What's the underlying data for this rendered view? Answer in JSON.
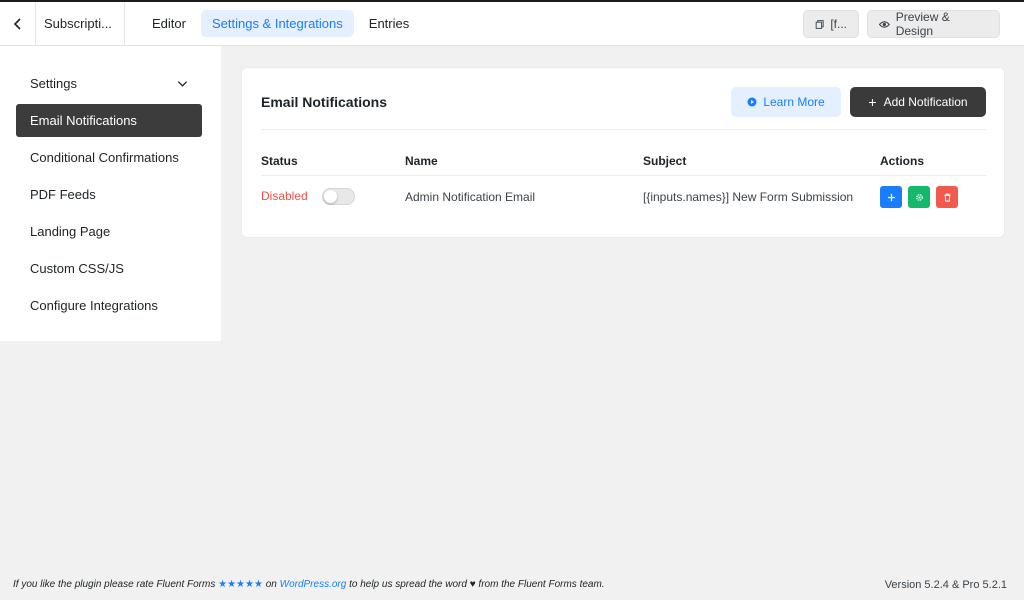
{
  "header": {
    "form_title": "Subscripti...",
    "tabs": [
      {
        "label": "Editor",
        "active": false
      },
      {
        "label": "Settings & Integrations",
        "active": true
      },
      {
        "label": "Entries",
        "active": false
      }
    ],
    "shortcode_label": "[f...",
    "preview_label": "Preview & Design"
  },
  "sidebar": {
    "items": [
      {
        "label": "Settings",
        "active": false,
        "has_chevron": true
      },
      {
        "label": "Email Notifications",
        "active": true
      },
      {
        "label": "Conditional Confirmations",
        "active": false
      },
      {
        "label": "PDF Feeds",
        "active": false
      },
      {
        "label": "Landing Page",
        "active": false
      },
      {
        "label": "Custom CSS/JS",
        "active": false
      },
      {
        "label": "Configure Integrations",
        "active": false
      }
    ]
  },
  "main": {
    "title": "Email Notifications",
    "learn_more_label": "Learn More",
    "add_notification_label": "Add Notification",
    "columns": [
      "Status",
      "Name",
      "Subject",
      "Actions"
    ],
    "rows": [
      {
        "status": "Disabled",
        "enabled": false,
        "name": "Admin Notification Email",
        "subject": "[{inputs.names}] New Form Submission"
      }
    ]
  },
  "footer": {
    "text_before": "If you like the plugin please rate Fluent Forms ",
    "stars": "★★★★★",
    "text_on": " on ",
    "link": "WordPress.org",
    "text_after": " to help us spread the word ♥ from the Fluent Forms team.",
    "version": "Version 5.2.4 & Pro 5.2.1"
  },
  "colors": {
    "accent": "#1a7efb",
    "accent_light": "#e4efff",
    "dark_button": "#3a3a3a",
    "danger": "#f04f45",
    "success": "#14b86a",
    "danger_button": "#f35a4f"
  },
  "icons": {
    "back": "chevron-left-icon",
    "shortcode": "copy-icon",
    "preview": "eye-icon",
    "learn_more": "play-circle-icon",
    "add": "plus-icon",
    "duplicate": "plus-icon",
    "settings": "gear-icon",
    "delete": "trash-icon"
  }
}
